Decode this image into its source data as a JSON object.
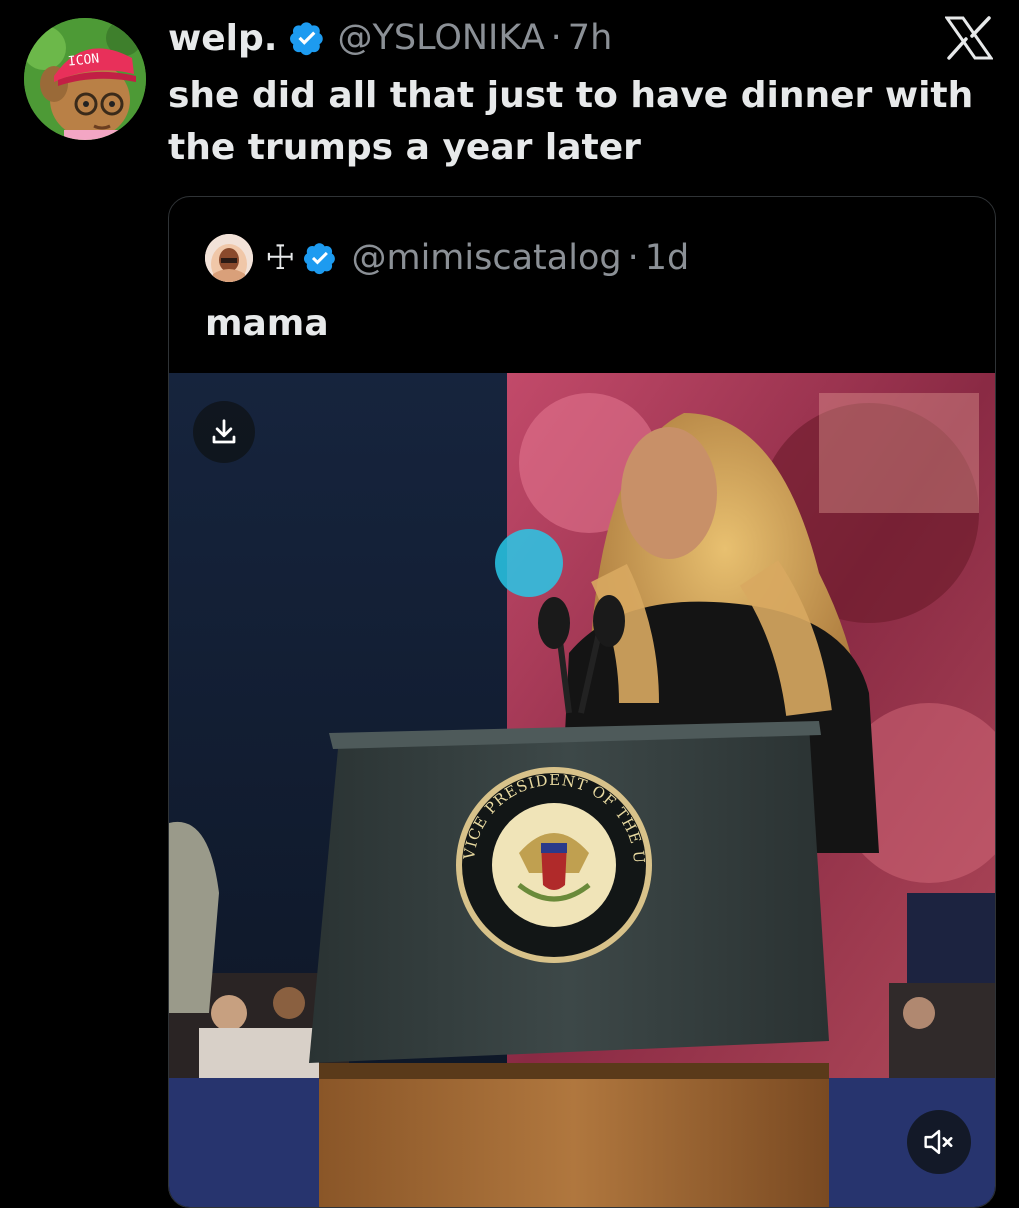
{
  "tweet": {
    "author_name": "welp.",
    "author_handle": "@YSLONIKA",
    "separator": "·",
    "time": "7h",
    "text": "she did all that just to have dinner with the trumps a year later",
    "avatar_hat_text": "ICON"
  },
  "quoted_tweet": {
    "name_symbol": "☩",
    "handle": "@mimiscatalog",
    "separator": "·",
    "time": "1d",
    "text": "mama"
  },
  "media": {
    "seal_text": "VICE PRESIDENT OF THE UNITED STATES"
  },
  "icons": {
    "verified": "verified-badge-icon",
    "x_logo": "x-logo-icon",
    "download": "download-icon",
    "mute": "speaker-muted-icon"
  },
  "colors": {
    "background": "#000000",
    "text_primary": "#e7e9ea",
    "text_secondary": "#8b9096",
    "verified_blue": "#1d9bf0",
    "border": "#2f3336"
  }
}
